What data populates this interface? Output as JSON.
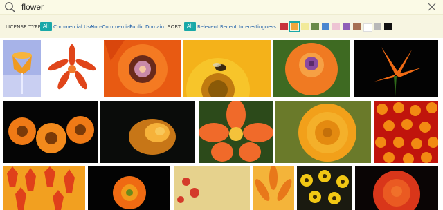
{
  "search": {
    "query": "flower"
  },
  "filters": {
    "license_label": "LICENSE TYPE:",
    "license_options": [
      "All",
      "Commercial Use",
      "Non-Commercial",
      "Public Domain"
    ],
    "sort_label": "SORT:",
    "sort_options": [
      "All",
      "Relevent",
      "Recent",
      "Interestingness"
    ],
    "colors": [
      "#c8323a",
      "#f0a63c",
      "#f2ea9a",
      "#6a8a4a",
      "#4a86d0",
      "#eec4d4",
      "#8f5fb8",
      "#a77052",
      "#ffffff",
      "#b8b8b8",
      "#111111"
    ],
    "selected_color": "#f0a63c"
  },
  "images": [
    {
      "subject": "crocus"
    },
    {
      "subject": "orange lily"
    },
    {
      "subject": "poppy close-up"
    },
    {
      "subject": "bee on yellow flower"
    },
    {
      "subject": "orange poppy"
    },
    {
      "subject": "bird of paradise"
    },
    {
      "subject": "three gerberas"
    },
    {
      "subject": "blurred rose"
    },
    {
      "subject": "daylily"
    },
    {
      "subject": "ranunculus"
    },
    {
      "subject": "gerbera pattern"
    },
    {
      "subject": "tulips"
    },
    {
      "subject": "gerbera"
    },
    {
      "subject": "painted poppies"
    },
    {
      "subject": "orange lily"
    },
    {
      "subject": "yellow daisies"
    },
    {
      "subject": "red rose"
    }
  ]
}
